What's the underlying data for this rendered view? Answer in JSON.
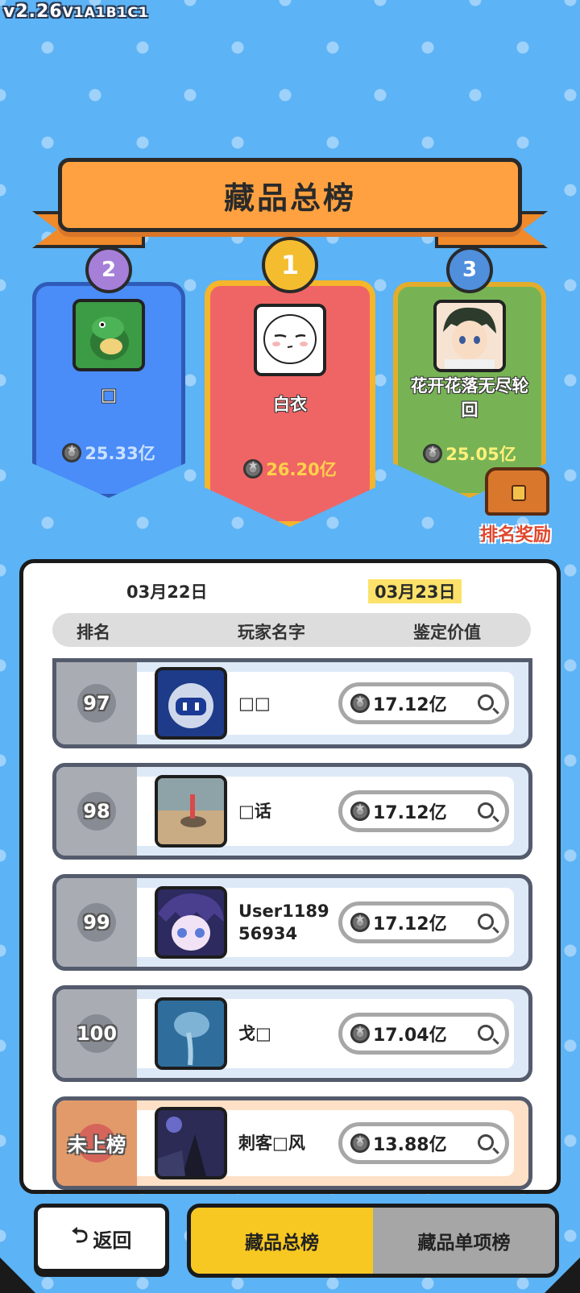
{
  "version": {
    "main": "v2.26",
    "sub": "V1A1B1C1"
  },
  "title": "藏品总榜",
  "podium": [
    {
      "rank": "2",
      "name": "□",
      "value": "25.33亿",
      "value_color": "#c9e1ff"
    },
    {
      "rank": "1",
      "name": "白衣",
      "value": "26.20亿",
      "value_color": "#ffd24a"
    },
    {
      "rank": "3",
      "name": "花开花落无尽轮回",
      "value": "25.05亿",
      "value_color": "#fff07a"
    }
  ],
  "reward": {
    "label": "排名奖励",
    "icon": "treasure-chest-icon"
  },
  "dates": {
    "prev": "03月22日",
    "current": "03月23日"
  },
  "columns": {
    "rank": "排名",
    "name": "玩家名字",
    "value": "鉴定价值"
  },
  "rows": [
    {
      "rank": "97",
      "name": "□□",
      "value": "17.12亿"
    },
    {
      "rank": "98",
      "name": "□话",
      "value": "17.12亿"
    },
    {
      "rank": "99",
      "name": "User118956934",
      "value": "17.12亿"
    },
    {
      "rank": "100",
      "name": "戈□",
      "value": "17.04亿"
    }
  ],
  "me": {
    "rank": "未上榜",
    "name": "刺客□风",
    "value": "13.88亿"
  },
  "nav": {
    "back": "返回",
    "tab_total": "藏品总榜",
    "tab_single": "藏品单项榜"
  },
  "colors": {
    "background": "#5cb3f5",
    "banner": "#ffa140",
    "active_tab": "#f7c821"
  }
}
